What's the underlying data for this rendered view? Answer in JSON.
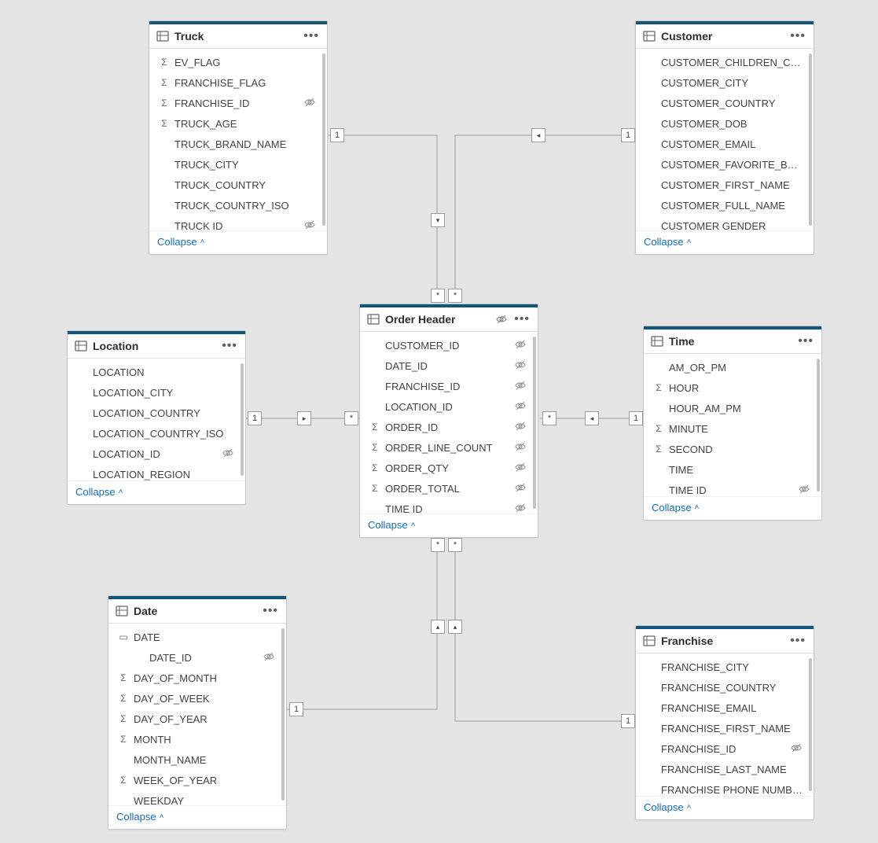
{
  "collapse_label": "Collapse",
  "tables": {
    "truck": {
      "title": "Truck",
      "header_hidden": false,
      "fields": [
        {
          "icon": "sigma",
          "name": "EV_FLAG",
          "hidden": false
        },
        {
          "icon": "sigma",
          "name": "FRANCHISE_FLAG",
          "hidden": false
        },
        {
          "icon": "sigma",
          "name": "FRANCHISE_ID",
          "hidden": true
        },
        {
          "icon": "sigma",
          "name": "TRUCK_AGE",
          "hidden": false
        },
        {
          "icon": "none",
          "name": "TRUCK_BRAND_NAME",
          "hidden": false
        },
        {
          "icon": "none",
          "name": "TRUCK_CITY",
          "hidden": false
        },
        {
          "icon": "none",
          "name": "TRUCK_COUNTRY",
          "hidden": false
        },
        {
          "icon": "none",
          "name": "TRUCK_COUNTRY_ISO",
          "hidden": false
        },
        {
          "icon": "none",
          "name": "TRUCK ID",
          "hidden": true
        }
      ]
    },
    "customer": {
      "title": "Customer",
      "header_hidden": false,
      "fields": [
        {
          "icon": "none",
          "name": "CUSTOMER_CHILDREN_COUNT",
          "hidden": false
        },
        {
          "icon": "none",
          "name": "CUSTOMER_CITY",
          "hidden": false
        },
        {
          "icon": "none",
          "name": "CUSTOMER_COUNTRY",
          "hidden": false
        },
        {
          "icon": "none",
          "name": "CUSTOMER_DOB",
          "hidden": false
        },
        {
          "icon": "none",
          "name": "CUSTOMER_EMAIL",
          "hidden": false
        },
        {
          "icon": "none",
          "name": "CUSTOMER_FAVORITE_BAND",
          "hidden": false
        },
        {
          "icon": "none",
          "name": "CUSTOMER_FIRST_NAME",
          "hidden": false
        },
        {
          "icon": "none",
          "name": "CUSTOMER_FULL_NAME",
          "hidden": false
        },
        {
          "icon": "none",
          "name": "CUSTOMER GENDER",
          "hidden": false
        }
      ]
    },
    "location": {
      "title": "Location",
      "header_hidden": false,
      "fields": [
        {
          "icon": "none",
          "name": "LOCATION",
          "hidden": false
        },
        {
          "icon": "none",
          "name": "LOCATION_CITY",
          "hidden": false
        },
        {
          "icon": "none",
          "name": "LOCATION_COUNTRY",
          "hidden": false
        },
        {
          "icon": "none",
          "name": "LOCATION_COUNTRY_ISO",
          "hidden": false
        },
        {
          "icon": "none",
          "name": "LOCATION_ID",
          "hidden": true
        },
        {
          "icon": "none",
          "name": "LOCATION_REGION",
          "hidden": false
        }
      ]
    },
    "orderheader": {
      "title": "Order Header",
      "header_hidden": true,
      "fields": [
        {
          "icon": "none",
          "name": "CUSTOMER_ID",
          "hidden": true
        },
        {
          "icon": "none",
          "name": "DATE_ID",
          "hidden": true
        },
        {
          "icon": "none",
          "name": "FRANCHISE_ID",
          "hidden": true
        },
        {
          "icon": "none",
          "name": "LOCATION_ID",
          "hidden": true
        },
        {
          "icon": "sigma",
          "name": "ORDER_ID",
          "hidden": true
        },
        {
          "icon": "sigma",
          "name": "ORDER_LINE_COUNT",
          "hidden": true
        },
        {
          "icon": "sigma",
          "name": "ORDER_QTY",
          "hidden": true
        },
        {
          "icon": "sigma",
          "name": "ORDER_TOTAL",
          "hidden": true
        },
        {
          "icon": "none",
          "name": "TIME ID",
          "hidden": true
        }
      ]
    },
    "time": {
      "title": "Time",
      "header_hidden": false,
      "fields": [
        {
          "icon": "none",
          "name": "AM_OR_PM",
          "hidden": false
        },
        {
          "icon": "sigma",
          "name": "HOUR",
          "hidden": false
        },
        {
          "icon": "none",
          "name": "HOUR_AM_PM",
          "hidden": false
        },
        {
          "icon": "sigma",
          "name": "MINUTE",
          "hidden": false
        },
        {
          "icon": "sigma",
          "name": "SECOND",
          "hidden": false
        },
        {
          "icon": "none",
          "name": "TIME",
          "hidden": false
        },
        {
          "icon": "none",
          "name": "TIME ID",
          "hidden": true
        }
      ]
    },
    "date": {
      "title": "Date",
      "header_hidden": false,
      "fields": [
        {
          "icon": "card",
          "name": "DATE",
          "hidden": false
        },
        {
          "icon": "none",
          "name": "DATE_ID",
          "hidden": true
        },
        {
          "icon": "sigma",
          "name": "DAY_OF_MONTH",
          "hidden": false
        },
        {
          "icon": "sigma",
          "name": "DAY_OF_WEEK",
          "hidden": false
        },
        {
          "icon": "sigma",
          "name": "DAY_OF_YEAR",
          "hidden": false
        },
        {
          "icon": "sigma",
          "name": "MONTH",
          "hidden": false
        },
        {
          "icon": "none",
          "name": "MONTH_NAME",
          "hidden": false
        },
        {
          "icon": "sigma",
          "name": "WEEK_OF_YEAR",
          "hidden": false
        },
        {
          "icon": "none",
          "name": "WEEKDAY",
          "hidden": false
        }
      ]
    },
    "franchise": {
      "title": "Franchise",
      "header_hidden": false,
      "fields": [
        {
          "icon": "none",
          "name": "FRANCHISE_CITY",
          "hidden": false
        },
        {
          "icon": "none",
          "name": "FRANCHISE_COUNTRY",
          "hidden": false
        },
        {
          "icon": "none",
          "name": "FRANCHISE_EMAIL",
          "hidden": false
        },
        {
          "icon": "none",
          "name": "FRANCHISE_FIRST_NAME",
          "hidden": false
        },
        {
          "icon": "none",
          "name": "FRANCHISE_ID",
          "hidden": true
        },
        {
          "icon": "none",
          "name": "FRANCHISE_LAST_NAME",
          "hidden": false
        },
        {
          "icon": "none",
          "name": "FRANCHISE PHONE NUMBER",
          "hidden": false
        }
      ]
    }
  },
  "cardinality": {
    "one": "1",
    "many": "*"
  },
  "rel_dir": {
    "down": "▾",
    "left": "◂",
    "right": "▸",
    "up": "▴"
  }
}
